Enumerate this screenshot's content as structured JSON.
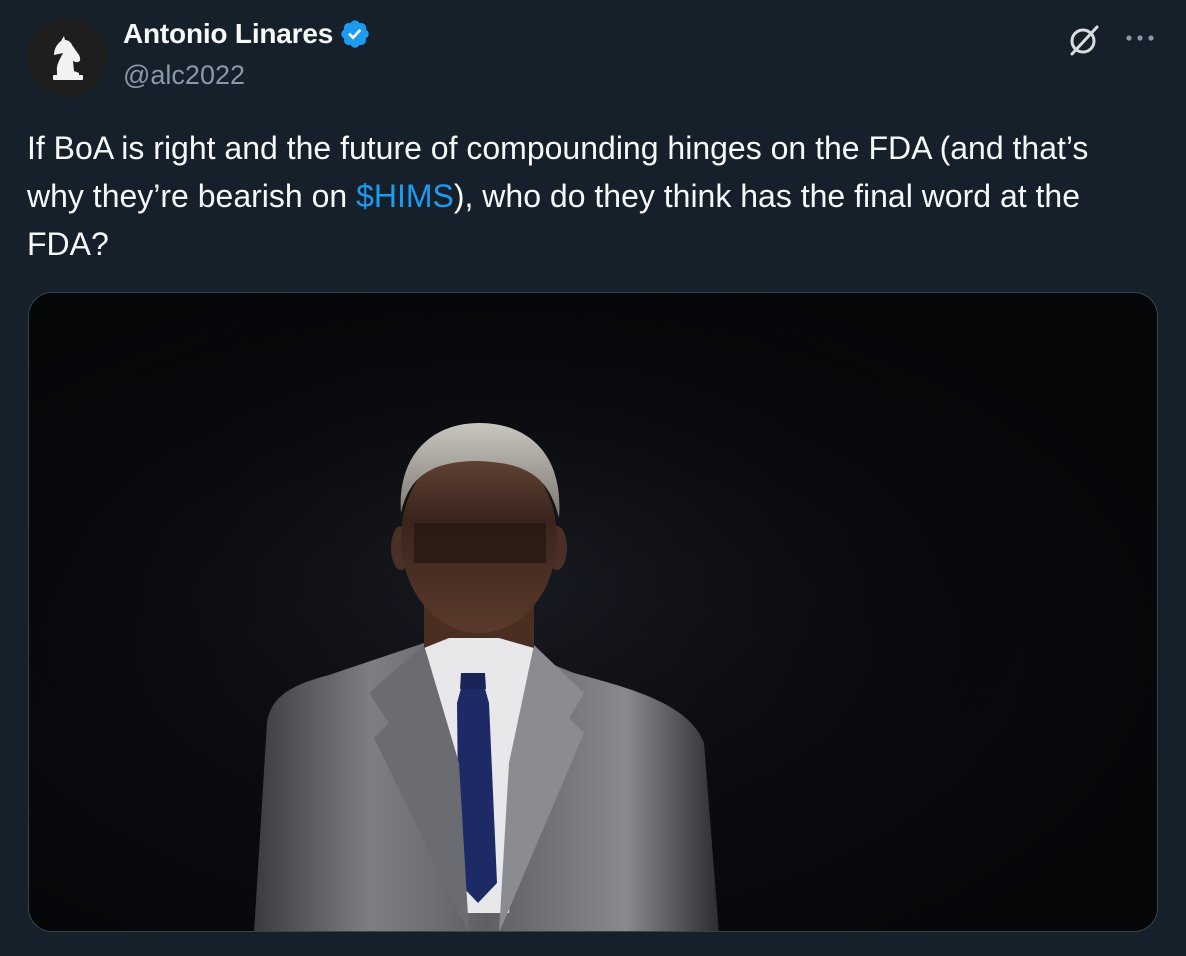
{
  "author": {
    "display_name": "Antonio Linares",
    "handle": "@alc2022",
    "verified": true,
    "avatar_icon": "knight-chess-icon"
  },
  "header_actions": {
    "grok_icon": "grok-icon",
    "more_icon": "more-icon"
  },
  "tweet": {
    "text_before": "If BoA is right and the future of compounding hinges on the FDA (and that’s why they’re bearish on ",
    "cashtag": "$HIMS",
    "text_after": "), who do they think has the final word at the FDA?"
  },
  "media": {
    "type": "photo",
    "icon": "photo-man-in-suit"
  },
  "colors": {
    "background": "#15202b",
    "text": "#f7f9f9",
    "secondary_text": "#8b98a5",
    "accent": "#1d9bf0",
    "border": "#38444d"
  }
}
